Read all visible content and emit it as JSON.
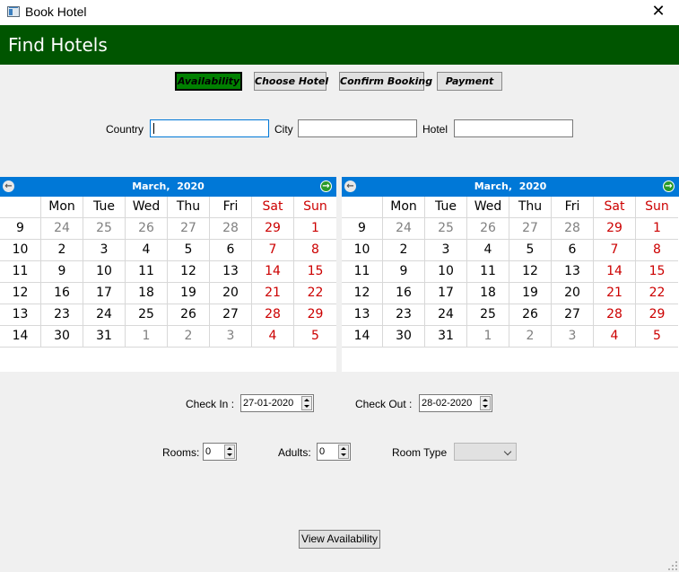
{
  "window": {
    "title": "Book Hotel",
    "close_glyph": "✕"
  },
  "header": {
    "title": "Find Hotels",
    "color": "#005500"
  },
  "steps": [
    {
      "label": "Availability",
      "active": true
    },
    {
      "label": "Choose Hotel",
      "active": false
    },
    {
      "label": "Confirm Booking",
      "active": false
    },
    {
      "label": "Payment",
      "active": false
    }
  ],
  "search": {
    "country_label": "Country",
    "country_value": "",
    "city_label": "City",
    "city_value": "",
    "hotel_label": "Hotel",
    "hotel_value": ""
  },
  "calendars": [
    {
      "month": "March,",
      "year": "2020",
      "prev_icon": "arrow-left-icon",
      "next_icon": "arrow-right-icon",
      "day_headers": [
        "Mon",
        "Tue",
        "Wed",
        "Thu",
        "Fri",
        "Sat",
        "Sun"
      ],
      "weeks": [
        {
          "week": "9",
          "days": [
            "24",
            "25",
            "26",
            "27",
            "28",
            "29",
            "1"
          ],
          "current": [
            false,
            false,
            false,
            false,
            false,
            false,
            true
          ]
        },
        {
          "week": "10",
          "days": [
            "2",
            "3",
            "4",
            "5",
            "6",
            "7",
            "8"
          ],
          "current": [
            true,
            true,
            true,
            true,
            true,
            true,
            true
          ]
        },
        {
          "week": "11",
          "days": [
            "9",
            "10",
            "11",
            "12",
            "13",
            "14",
            "15"
          ],
          "current": [
            true,
            true,
            true,
            true,
            true,
            true,
            true
          ]
        },
        {
          "week": "12",
          "days": [
            "16",
            "17",
            "18",
            "19",
            "20",
            "21",
            "22"
          ],
          "current": [
            true,
            true,
            true,
            true,
            true,
            true,
            true
          ]
        },
        {
          "week": "13",
          "days": [
            "23",
            "24",
            "25",
            "26",
            "27",
            "28",
            "29"
          ],
          "current": [
            true,
            true,
            true,
            true,
            true,
            true,
            true
          ]
        },
        {
          "week": "14",
          "days": [
            "30",
            "31",
            "1",
            "2",
            "3",
            "4",
            "5"
          ],
          "current": [
            true,
            true,
            false,
            false,
            false,
            false,
            false
          ]
        }
      ]
    },
    {
      "month": "March,",
      "year": "2020",
      "prev_icon": "arrow-left-icon",
      "next_icon": "arrow-right-icon",
      "day_headers": [
        "Mon",
        "Tue",
        "Wed",
        "Thu",
        "Fri",
        "Sat",
        "Sun"
      ],
      "weeks": [
        {
          "week": "9",
          "days": [
            "24",
            "25",
            "26",
            "27",
            "28",
            "29",
            "1"
          ],
          "current": [
            false,
            false,
            false,
            false,
            false,
            false,
            true
          ]
        },
        {
          "week": "10",
          "days": [
            "2",
            "3",
            "4",
            "5",
            "6",
            "7",
            "8"
          ],
          "current": [
            true,
            true,
            true,
            true,
            true,
            true,
            true
          ]
        },
        {
          "week": "11",
          "days": [
            "9",
            "10",
            "11",
            "12",
            "13",
            "14",
            "15"
          ],
          "current": [
            true,
            true,
            true,
            true,
            true,
            true,
            true
          ]
        },
        {
          "week": "12",
          "days": [
            "16",
            "17",
            "18",
            "19",
            "20",
            "21",
            "22"
          ],
          "current": [
            true,
            true,
            true,
            true,
            true,
            true,
            true
          ]
        },
        {
          "week": "13",
          "days": [
            "23",
            "24",
            "25",
            "26",
            "27",
            "28",
            "29"
          ],
          "current": [
            true,
            true,
            true,
            true,
            true,
            true,
            true
          ]
        },
        {
          "week": "14",
          "days": [
            "30",
            "31",
            "1",
            "2",
            "3",
            "4",
            "5"
          ],
          "current": [
            true,
            true,
            false,
            false,
            false,
            false,
            false
          ]
        }
      ]
    }
  ],
  "dates": {
    "check_in_label": "Check In :",
    "check_in_value": "27-01-2020",
    "check_out_label": "Check Out :",
    "check_out_value": "28-02-2020"
  },
  "booking": {
    "rooms_label": "Rooms:",
    "rooms_value": "0",
    "adults_label": "Adults:",
    "adults_value": "0",
    "room_type_label": "Room Type",
    "room_type_value": ""
  },
  "actions": {
    "view_label": "View Availability"
  },
  "colors": {
    "calendar_header": "#0078d7",
    "weekend": "#cc0000",
    "active_step": "#008000"
  }
}
